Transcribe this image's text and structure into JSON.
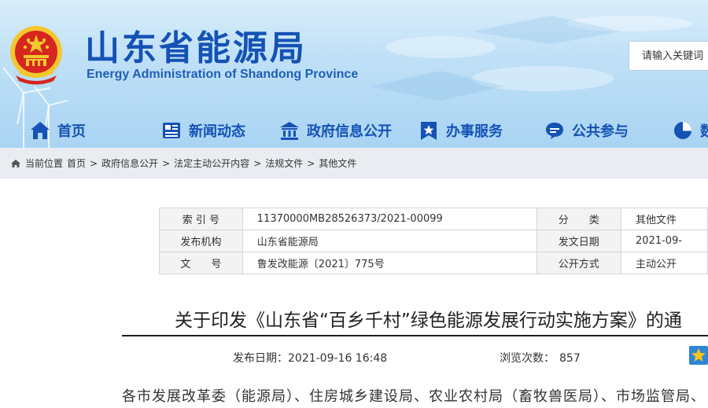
{
  "header": {
    "title_cn": "山东省能源局",
    "title_en": "Energy Administration of Shandong Province"
  },
  "search": {
    "placeholder": "请输入关键词"
  },
  "nav": {
    "items": [
      {
        "label": "首页",
        "icon": "home-icon"
      },
      {
        "label": "新闻动态",
        "icon": "newspaper-icon"
      },
      {
        "label": "政府信息公开",
        "icon": "government-building-icon"
      },
      {
        "label": "办事服务",
        "icon": "star-service-icon"
      },
      {
        "label": "公共参与",
        "icon": "chat-bubble-icon"
      },
      {
        "label": "数",
        "icon": "pie-chart-icon"
      }
    ]
  },
  "breadcrumb": {
    "prefix": "当前位置",
    "items": [
      "首页",
      "政府信息公开",
      "法定主动公开内容",
      "法规文件",
      "其他文件"
    ]
  },
  "info_table": {
    "rows": [
      [
        "索 引 号",
        "11370000MB28526373/2021-00099",
        "分　　类",
        "其他文件"
      ],
      [
        "发布机构",
        "山东省能源局",
        "发文日期",
        "2021-09-"
      ],
      [
        "文　　号",
        "鲁发改能源〔2021〕775号",
        "公开方式",
        "主动公开"
      ]
    ]
  },
  "article": {
    "title": "关于印发《山东省“百乡千村”绿色能源发展行动实施方案》的通",
    "publish_label": "发布日期：",
    "publish_date": "2021-09-16 16:48",
    "views_label": "浏览次数：",
    "views": "857",
    "body_first_line": "各市发展改革委（能源局）、住房城乡建设局、农业农村局（畜牧兽医局）、市场监管局、"
  },
  "colors": {
    "brand_blue": "#1552b4",
    "header_bg": "#bfe0f7",
    "emblem_red": "#d7261e",
    "emblem_gold": "#f3c72f",
    "breadcrumb_bg": "#e9edf2"
  }
}
